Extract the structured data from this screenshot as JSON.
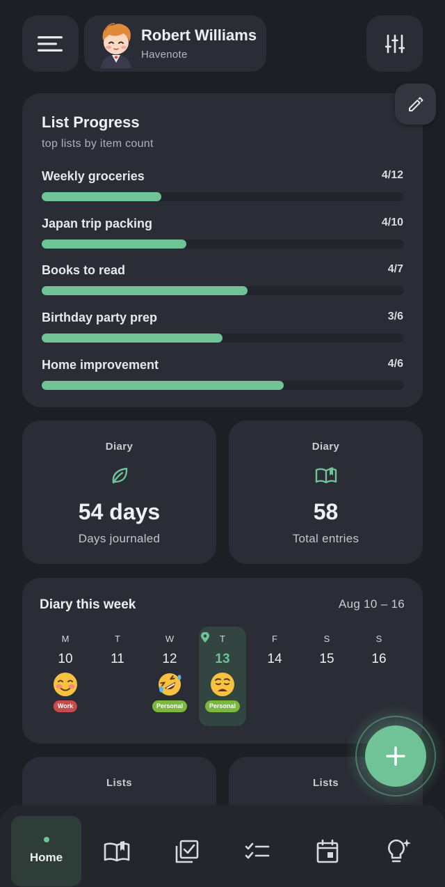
{
  "header": {
    "user_name": "Robert Williams",
    "app_name": "Havenote",
    "icons": {
      "menu": "menu-icon",
      "avatar": "avatar-illustration",
      "filter": "sliders-icon"
    }
  },
  "list_progress": {
    "title": "List Progress",
    "subtitle": "top lists by item count",
    "edit_icon": "pencil-icon",
    "items": [
      {
        "name": "Weekly groceries",
        "count": "4/12",
        "progress": 0.33
      },
      {
        "name": "Japan trip packing",
        "count": "4/10",
        "progress": 0.4
      },
      {
        "name": "Books to read",
        "count": "4/7",
        "progress": 0.57
      },
      {
        "name": "Birthday party prep",
        "count": "3/6",
        "progress": 0.5
      },
      {
        "name": "Home improvement",
        "count": "4/6",
        "progress": 0.67
      }
    ]
  },
  "stats": [
    {
      "label": "Diary",
      "icon": "leaf-icon",
      "value": "54 days",
      "caption": "Days journaled"
    },
    {
      "label": "Diary",
      "icon": "open-book-icon",
      "value": "58",
      "caption": "Total entries"
    }
  ],
  "diary_week": {
    "title": "Diary this week",
    "range": "Aug 10 – 16",
    "days": [
      {
        "letter": "M",
        "num": "10",
        "emoji": "smiling-blush",
        "tag": "Work"
      },
      {
        "letter": "T",
        "num": "11"
      },
      {
        "letter": "W",
        "num": "12",
        "emoji": "rofl",
        "tag": "Personal"
      },
      {
        "letter": "T",
        "num": "13",
        "emoji": "weary",
        "tag": "Personal",
        "today": true
      },
      {
        "letter": "F",
        "num": "14"
      },
      {
        "letter": "S",
        "num": "15"
      },
      {
        "letter": "S",
        "num": "16"
      }
    ]
  },
  "lower_cards": [
    {
      "label": "Lists"
    },
    {
      "label": "Lists"
    }
  ],
  "fab": {
    "icon": "plus-icon"
  },
  "bottom_nav": {
    "home_label": "Home",
    "items": [
      "home",
      "diary-book-icon",
      "checkbox-stack-icon",
      "checklist-icon",
      "calendar-icon",
      "lightbulb-sparkle-icon"
    ]
  },
  "colors": {
    "accent": "#6fc397",
    "card": "#2a2d36",
    "background": "#1d1f25",
    "work_tag": "#c84a4a",
    "personal_tag": "#7ab83e"
  }
}
